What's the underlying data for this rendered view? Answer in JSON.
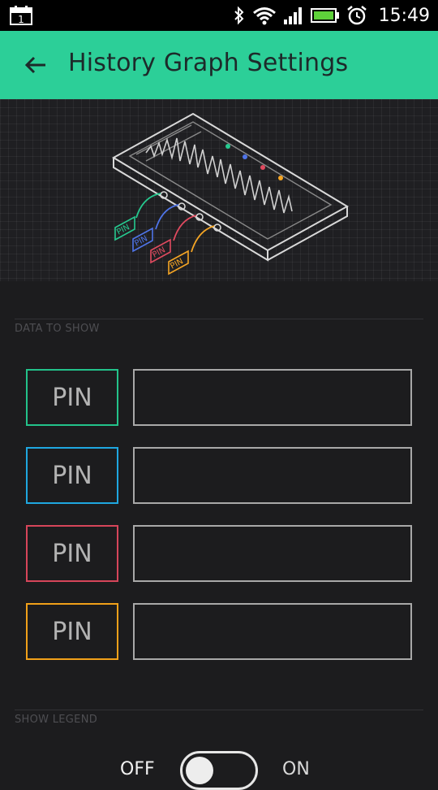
{
  "status_bar": {
    "time": "15:49",
    "calendar_day": "1",
    "icons": [
      "calendar-icon",
      "bluetooth-icon",
      "wifi-icon",
      "signal-icon",
      "battery-icon",
      "alarm-icon"
    ]
  },
  "header": {
    "title": "History Graph Settings",
    "back_icon": "arrow-left-icon",
    "color": "#2ccf98"
  },
  "illustration": {
    "pin_labels": [
      "PIN",
      "PIN",
      "PIN",
      "PIN"
    ],
    "pin_colors": [
      "#26c98f",
      "#4f74e8",
      "#e04a5f",
      "#f5a524"
    ]
  },
  "data_section": {
    "label": "DATA TO SHOW",
    "rows": [
      {
        "pin_label": "PIN",
        "color": "#23c28a",
        "value": ""
      },
      {
        "pin_label": "PIN",
        "color": "#1fa7e0",
        "value": ""
      },
      {
        "pin_label": "PIN",
        "color": "#d6455a",
        "value": ""
      },
      {
        "pin_label": "PIN",
        "color": "#f0a019",
        "value": ""
      }
    ]
  },
  "legend_section": {
    "label": "SHOW LEGEND",
    "off_label": "OFF",
    "on_label": "ON",
    "state": "off"
  }
}
